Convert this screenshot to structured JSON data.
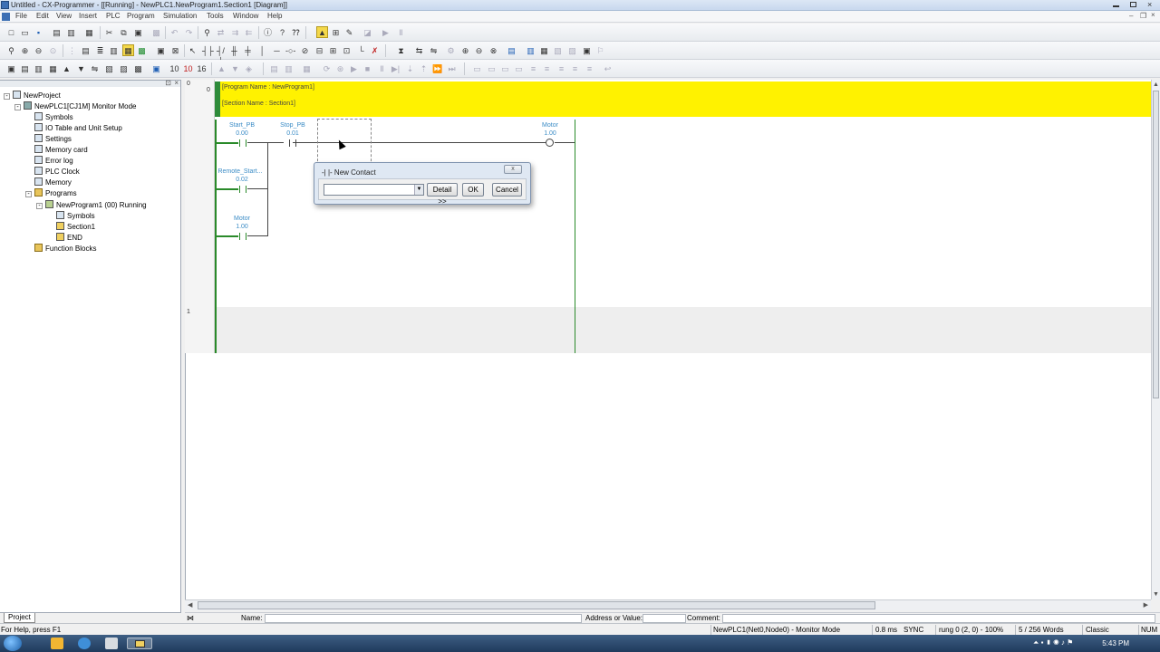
{
  "window": {
    "title": "Untitled - CX-Programmer - [[Running] - NewPLC1.NewProgram1.Section1 [Diagram]]"
  },
  "menu": [
    "File",
    "Edit",
    "View",
    "Insert",
    "PLC",
    "Program",
    "Simulation",
    "Tools",
    "Window",
    "Help"
  ],
  "tree": {
    "items": [
      {
        "label": "NewProject",
        "indent": 0,
        "icon": "project-icon",
        "expander": "-"
      },
      {
        "label": "NewPLC1[CJ1M] Monitor Mode",
        "indent": 1,
        "icon": "plc-icon",
        "expander": "-"
      },
      {
        "label": "Symbols",
        "indent": 2,
        "icon": "symbols-icon",
        "expander": ""
      },
      {
        "label": "IO Table and Unit Setup",
        "indent": 2,
        "icon": "io-table-icon",
        "expander": ""
      },
      {
        "label": "Settings",
        "indent": 2,
        "icon": "settings-icon",
        "expander": ""
      },
      {
        "label": "Memory card",
        "indent": 2,
        "icon": "memory-card-icon",
        "expander": ""
      },
      {
        "label": "Error log",
        "indent": 2,
        "icon": "error-log-icon",
        "expander": ""
      },
      {
        "label": "PLC Clock",
        "indent": 2,
        "icon": "clock-icon",
        "expander": ""
      },
      {
        "label": "Memory",
        "indent": 2,
        "icon": "memory-icon",
        "expander": ""
      },
      {
        "label": "Programs",
        "indent": 2,
        "icon": "programs-folder-icon",
        "expander": "-"
      },
      {
        "label": "NewProgram1 (00) Running",
        "indent": 3,
        "icon": "program-icon",
        "expander": "-"
      },
      {
        "label": "Symbols",
        "indent": 4,
        "icon": "symbols-icon",
        "expander": ""
      },
      {
        "label": "Section1",
        "indent": 4,
        "icon": "section-icon",
        "expander": ""
      },
      {
        "label": "END",
        "indent": 4,
        "icon": "section-icon",
        "expander": ""
      },
      {
        "label": "Function Blocks",
        "indent": 2,
        "icon": "function-blocks-icon",
        "expander": ""
      }
    ],
    "tab_label": "Project"
  },
  "diagram": {
    "rung0_number": "0",
    "rung1_number": "1",
    "program_name": "[Program Name : NewProgram1]",
    "section_name": "[Section Name : Section1]",
    "contacts": [
      {
        "name": "Start_PB",
        "addr": "0.00"
      },
      {
        "name": "Stop_PB",
        "addr": "0.01"
      },
      {
        "name": "Remote_Start...",
        "addr": "0.02"
      },
      {
        "name": "Motor",
        "addr": "1.00"
      }
    ],
    "coil": {
      "name": "Motor",
      "addr": "1.00"
    }
  },
  "dialog": {
    "title": "-| |- New Contact",
    "close_label": "x",
    "combo_value": "",
    "detail_label": "Detail >>",
    "ok_label": "OK",
    "cancel_label": "Cancel"
  },
  "infobar": {
    "name_label": "Name:",
    "address_label": "Address or Value:",
    "comment_label": "Comment:"
  },
  "status": {
    "help": "For Help, press F1",
    "connection": "NewPLC1(Net0,Node0) - Monitor Mode",
    "scan": "0.8 ms",
    "sync": "SYNC",
    "rung": "rung 0 (2, 0)  - 100%",
    "words": "5 / 256 Words",
    "style": "Classic",
    "num": "NUM"
  },
  "taskbar": {
    "clock": "5:43 PM"
  }
}
